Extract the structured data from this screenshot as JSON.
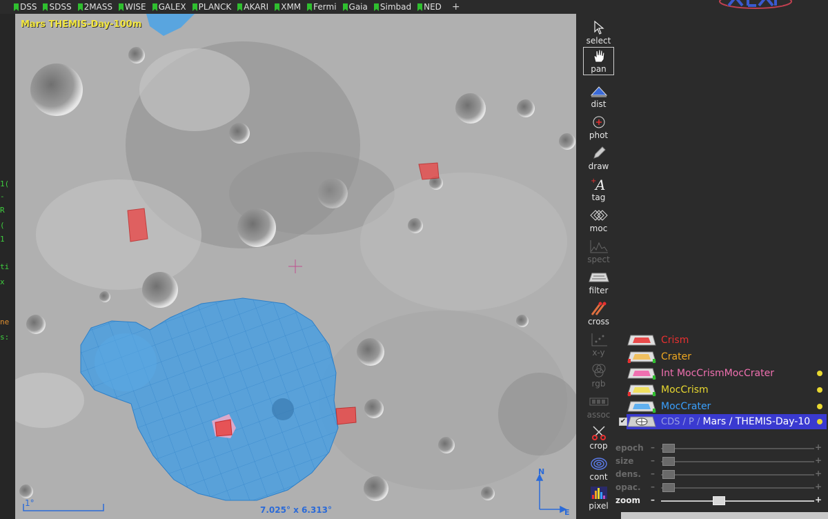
{
  "surveys": [
    {
      "label": "DSS"
    },
    {
      "label": "SDSS"
    },
    {
      "label": "2MASS"
    },
    {
      "label": "WISE"
    },
    {
      "label": "GALEX"
    },
    {
      "label": "PLANCK"
    },
    {
      "label": "AKARI"
    },
    {
      "label": "XMM"
    },
    {
      "label": "Fermi"
    },
    {
      "label": "Gaia"
    },
    {
      "label": "Simbad"
    },
    {
      "label": "NED"
    }
  ],
  "add_survey_label": "+",
  "map": {
    "survey_label": "Mars THEMIS-Day-100m",
    "fov": "7.025° x 6.313°",
    "scale": "1°",
    "compass_n": "N",
    "compass_e": "E"
  },
  "tools": [
    {
      "label": "select",
      "icon": "cursor-icon"
    },
    {
      "label": "pan",
      "icon": "hand-icon"
    },
    {
      "label": "dist",
      "icon": "distance-icon"
    },
    {
      "label": "phot",
      "icon": "photometry-icon"
    },
    {
      "label": "draw",
      "icon": "pencil-icon"
    },
    {
      "label": "tag",
      "icon": "tag-icon"
    },
    {
      "label": "moc",
      "icon": "moc-icon"
    },
    {
      "label": "spect",
      "icon": "spectrum-icon"
    },
    {
      "label": "filter",
      "icon": "filter-icon"
    },
    {
      "label": "cross",
      "icon": "cross-match-icon"
    },
    {
      "label": "x-y",
      "icon": "xy-plot-icon"
    },
    {
      "label": "rgb",
      "icon": "rgb-icon"
    },
    {
      "label": "assoc",
      "icon": "assoc-icon"
    },
    {
      "label": "crop",
      "icon": "scissors-icon"
    },
    {
      "label": "cont",
      "icon": "contour-icon"
    },
    {
      "label": "pixel",
      "icon": "histogram-icon"
    }
  ],
  "layers": [
    {
      "name": "Crism",
      "color": "#e83030"
    },
    {
      "name": "Crater",
      "color": "#f0a820"
    },
    {
      "name": "Int MocCrismMocCrater",
      "color": "#f070b0"
    },
    {
      "name": "MocCrism",
      "color": "#e8d830"
    },
    {
      "name": "MocCrater",
      "color": "#3aa0ff"
    },
    {
      "name_prefix": "CDS / P / ",
      "name": "Mars / THEMIS-Day-10",
      "color": "#ffffff"
    }
  ],
  "sliders": [
    {
      "label": "epoch",
      "minus": "–",
      "plus": "+"
    },
    {
      "label": "size",
      "minus": "–",
      "plus": "+"
    },
    {
      "label": "dens.",
      "minus": "–",
      "plus": "+"
    },
    {
      "label": "opac.",
      "minus": "–",
      "plus": "+"
    },
    {
      "label": "zoom",
      "minus": "–",
      "plus": "+"
    }
  ],
  "left_strip": [
    "1(",
    "-",
    "R",
    "(",
    "1",
    "ti",
    "x",
    "ne",
    "s:"
  ],
  "layer_checkbox": "✔",
  "colors": {
    "moc_crater": "#3f9fe8",
    "crism": "#e84040",
    "survey_label": "#f2e640",
    "flag_green": "#2fbf2f"
  }
}
